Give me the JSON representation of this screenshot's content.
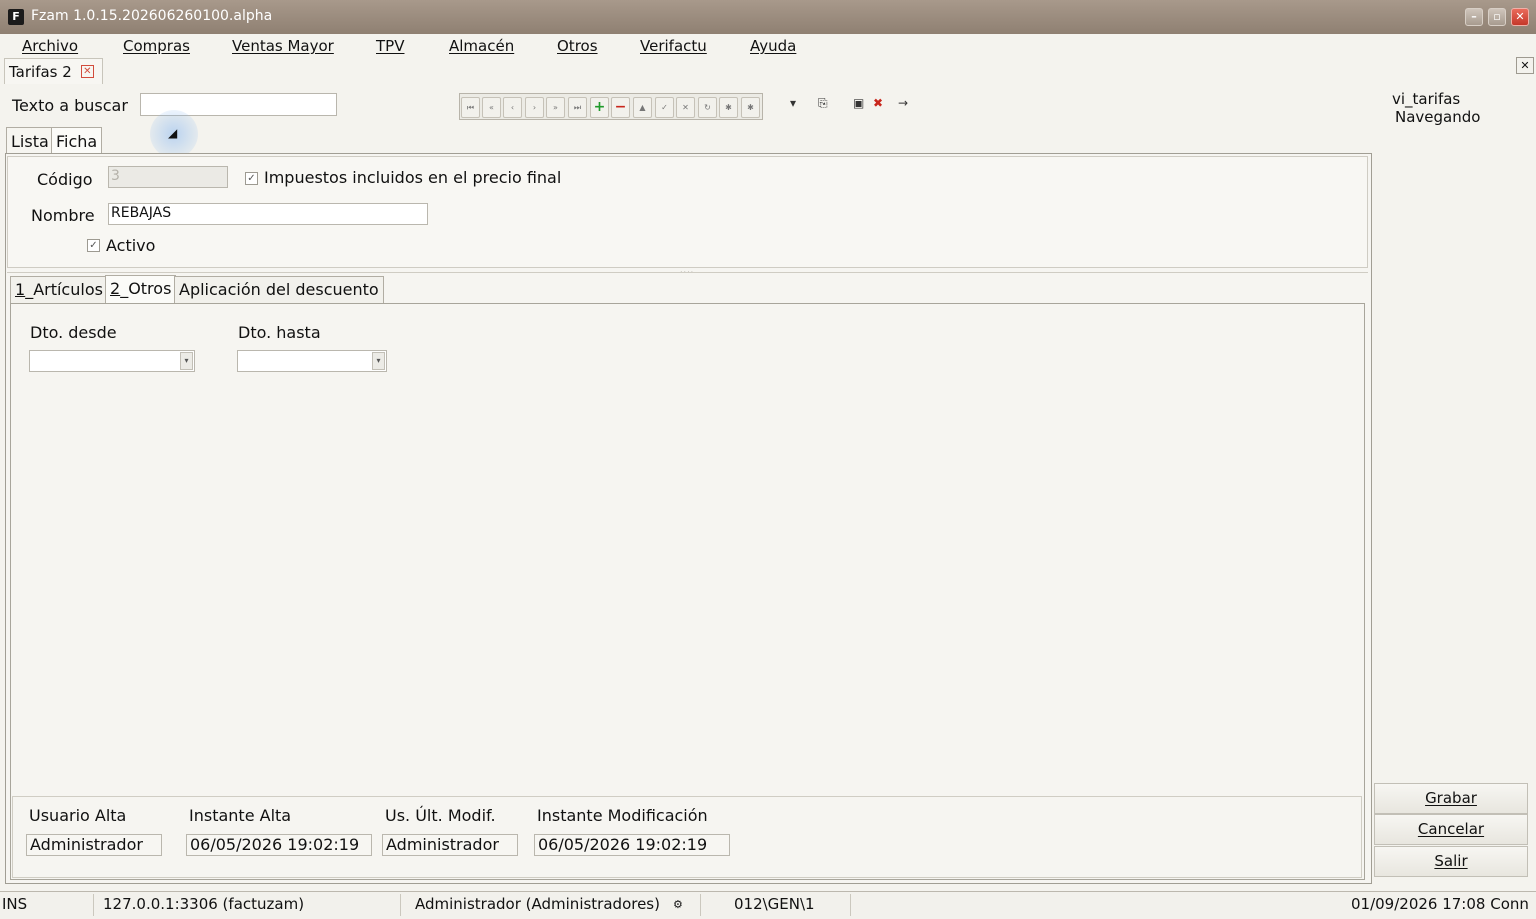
{
  "window": {
    "title": "Fzam 1.0.15.202606260100.alpha",
    "app_icon": "F",
    "minimize": "–",
    "restore": "▫",
    "close": "✕"
  },
  "menu": [
    "Archivo",
    "Compras",
    "Ventas Mayor",
    "TPV",
    "Almacén",
    "Otros",
    "Verifactu",
    "Ayuda"
  ],
  "doc_tab": {
    "label": "Tarifas 2",
    "close": "✕"
  },
  "panel_close": "✕",
  "search": {
    "label": "Texto a buscar",
    "value": ""
  },
  "navigator": {
    "buttons": [
      "first",
      "prev-page",
      "prev",
      "next",
      "next-page",
      "last",
      "insert",
      "delete",
      "edit",
      "post",
      "cancel",
      "refresh",
      "apply-updates",
      "cancel-updates"
    ],
    "glyphs": [
      "⏮",
      "«",
      "‹",
      "›",
      "»",
      "⏭",
      "+",
      "−",
      "▲",
      "✓",
      "✕",
      "↻",
      "✱",
      "✱"
    ]
  },
  "toolbar_icons": {
    "dropdown": "▾",
    "copy": "⎘",
    "save_close": "▣",
    "delete": "✖",
    "arrow": "→"
  },
  "view": {
    "name": "vi_tarifas",
    "state": "Navegando"
  },
  "mode_tabs": [
    "Lista",
    "Ficha"
  ],
  "form": {
    "codigo_label": "Código",
    "codigo_value": "3",
    "impuestos_label": "Impuestos incluidos en el precio final",
    "impuestos_checked": true,
    "nombre_label": "Nombre",
    "nombre_value": "REBAJAS",
    "activo_label": "Activo",
    "activo_checked": true,
    "check_glyph": "✓"
  },
  "sub_tabs": [
    {
      "label_u": "1",
      "label_rest": "_Artículos"
    },
    {
      "label_u": "2",
      "label_rest": "_Otros"
    },
    {
      "label_u": "",
      "label_rest": "Aplicación del descuento"
    }
  ],
  "otros": {
    "dto_desde_label": "Dto. desde",
    "dto_desde_value": "",
    "dto_hasta_label": "Dto. hasta",
    "dto_hasta_value": "",
    "combo_glyph": "▾"
  },
  "audit": {
    "usuario_alta_label": "Usuario Alta",
    "usuario_alta": "Administrador",
    "instante_alta_label": "Instante Alta",
    "instante_alta": "06/05/2026 19:02:19",
    "us_ult_modif_label": "Us. Últ. Modif.",
    "us_ult_modif": "Administrador",
    "instante_modif_label": "Instante Modificación",
    "instante_modif": "06/05/2026 19:02:19"
  },
  "actions": {
    "grabar": "Grabar",
    "cancelar": "Cancelar",
    "salir": "Salir"
  },
  "status": {
    "mode": "INS",
    "connection": "127.0.0.1:3306 (factuzam)",
    "user": "Administrador (Administradores)",
    "user_icon": "⚙",
    "path": "012\\GEN\\1",
    "datetime": "01/09/2026 17:08 Conn"
  },
  "colors": {
    "titlebar": "#9b8c7e",
    "background": "#f4f3ee",
    "close_red": "#d24c3c",
    "insert_green": "#1f9a2a",
    "delete_red": "#c8261c"
  }
}
